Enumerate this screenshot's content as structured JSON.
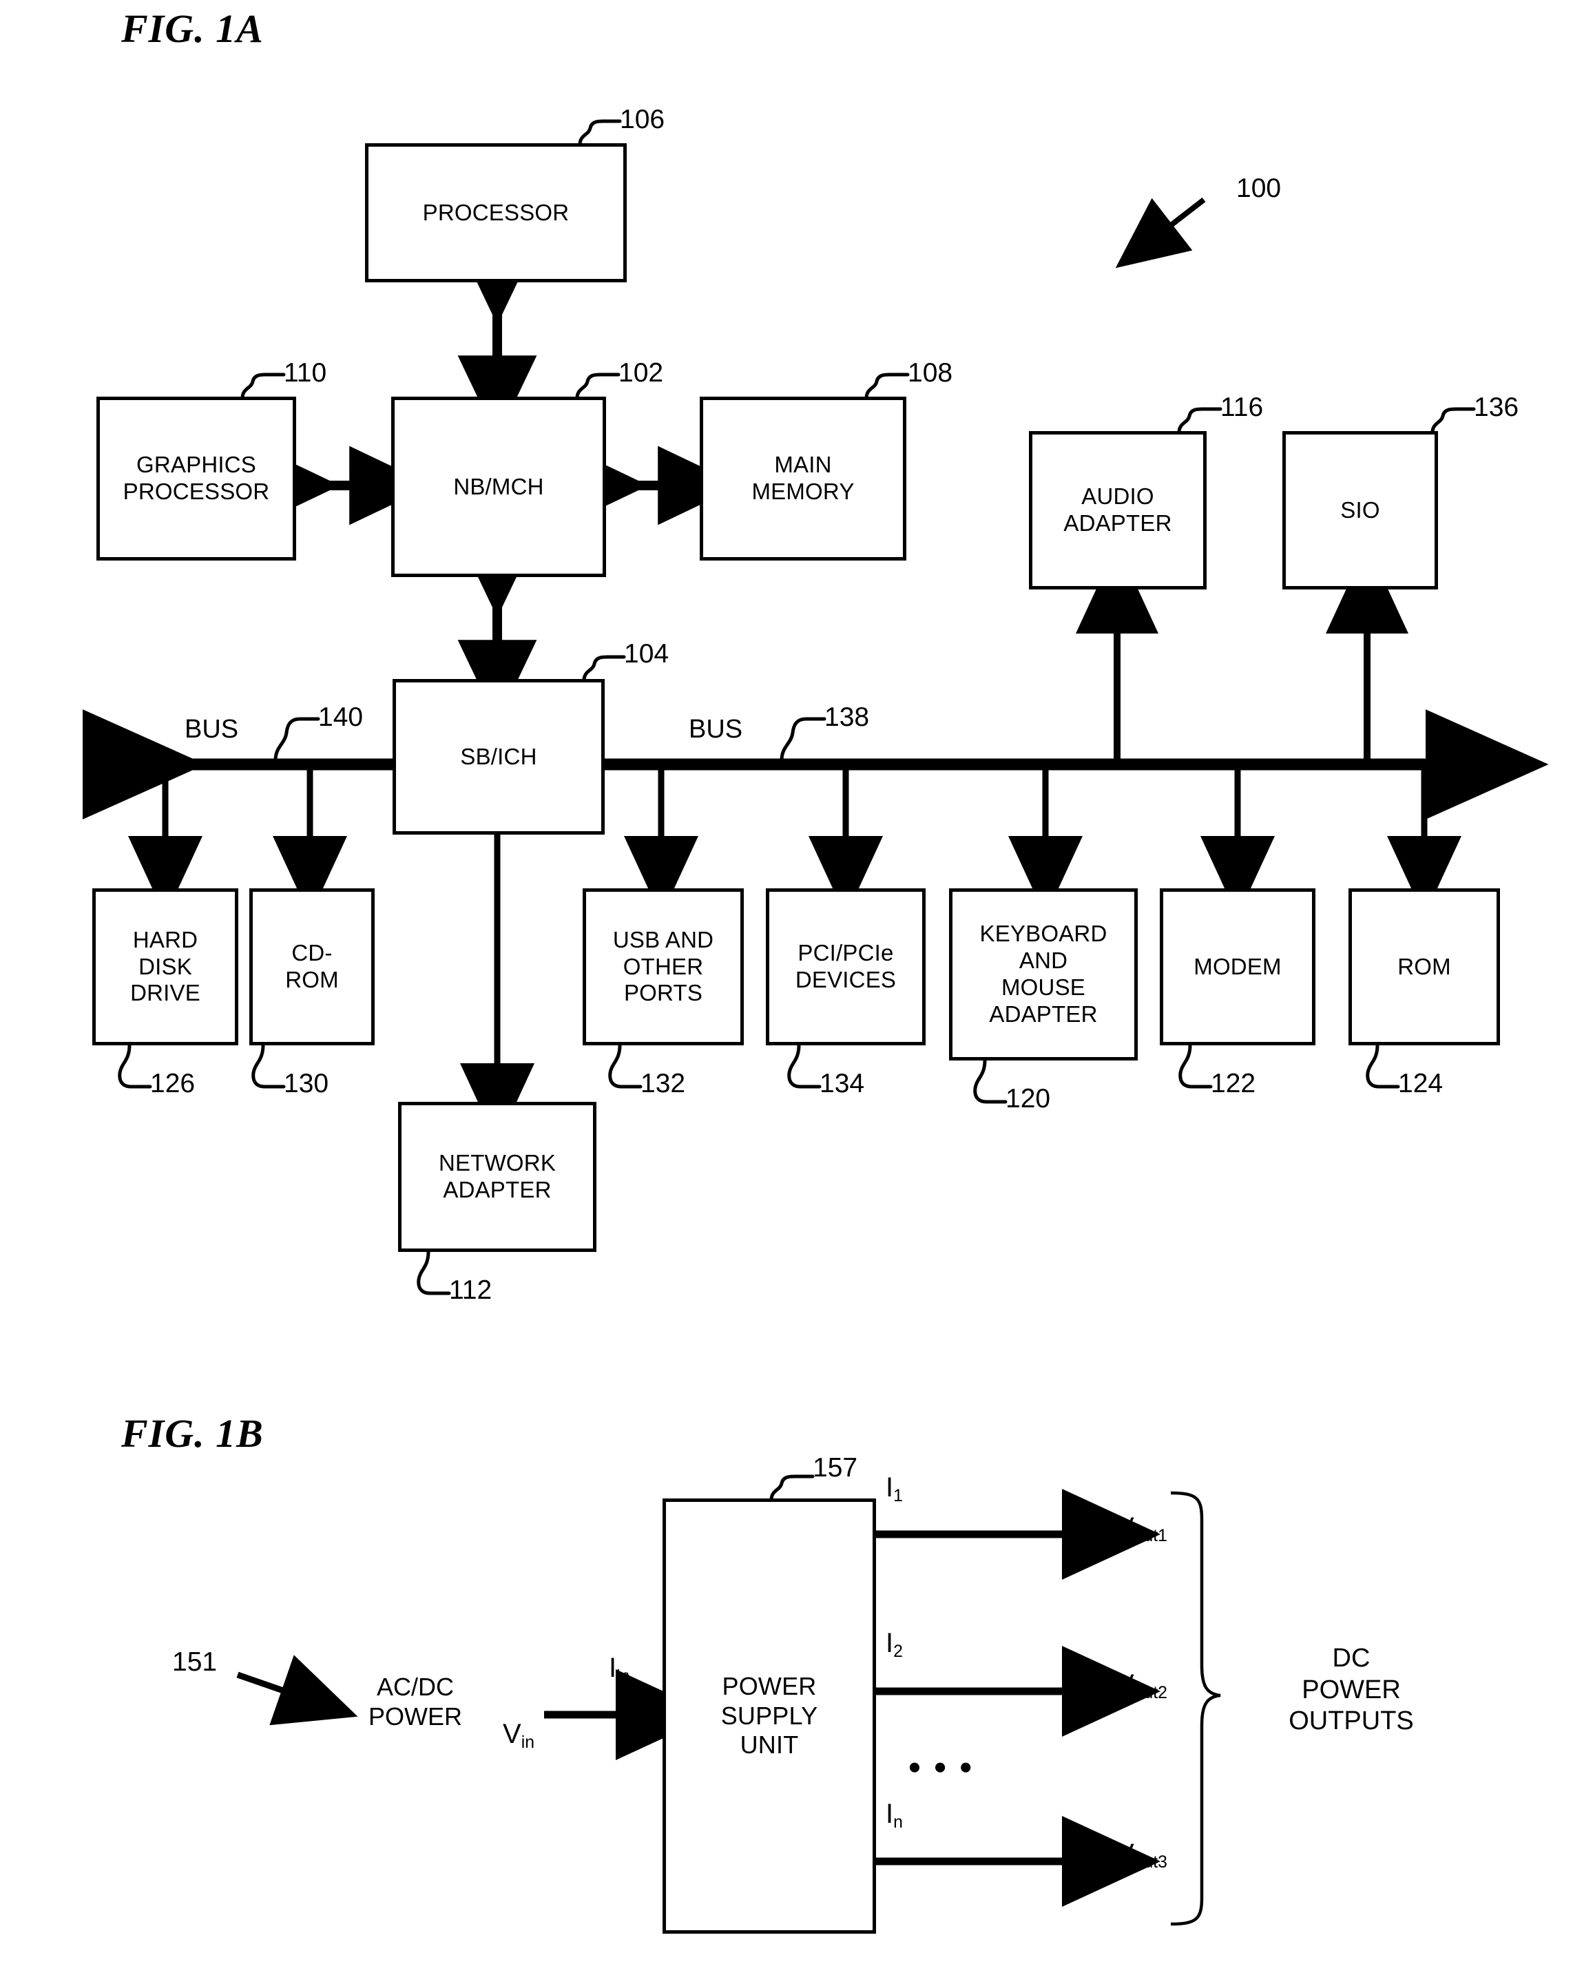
{
  "figures": {
    "fig1a_title": "FIG. 1A",
    "fig1b_title": "FIG. 1B"
  },
  "fig1a": {
    "system_ref": "100",
    "blocks": [
      {
        "label": "PROCESSOR",
        "ref": "106"
      },
      {
        "label": "GRAPHICS\nPROCESSOR",
        "ref": "110"
      },
      {
        "label": "NB/MCH",
        "ref": "102"
      },
      {
        "label": "MAIN\nMEMORY",
        "ref": "108"
      },
      {
        "label": "AUDIO\nADAPTER",
        "ref": "116"
      },
      {
        "label": "SIO",
        "ref": "136"
      },
      {
        "label": "SB/ICH",
        "ref": "104"
      },
      {
        "label": "HARD\nDISK\nDRIVE",
        "ref": "126"
      },
      {
        "label": "CD-\nROM",
        "ref": "130"
      },
      {
        "label": "USB AND\nOTHER\nPORTS",
        "ref": "132"
      },
      {
        "label": "PCI/PCIe\nDEVICES",
        "ref": "134"
      },
      {
        "label": "KEYBOARD\nAND\nMOUSE\nADAPTER",
        "ref": "120"
      },
      {
        "label": "MODEM",
        "ref": "122"
      },
      {
        "label": "ROM",
        "ref": "124"
      },
      {
        "label": "NETWORK\nADAPTER",
        "ref": "112"
      }
    ],
    "bus_left": {
      "label": "BUS",
      "ref": "140"
    },
    "bus_right": {
      "label": "BUS",
      "ref": "138"
    }
  },
  "fig1b": {
    "source_ref": "151",
    "source_label": "AC/DC\nPOWER",
    "psu_label": "POWER\nSUPPLY\nUNIT",
    "psu_ref": "157",
    "input_current": "I",
    "input_current_sub": "in",
    "input_voltage": "V",
    "input_voltage_sub": "in",
    "currents": [
      {
        "base": "I",
        "sub": "1"
      },
      {
        "base": "I",
        "sub": "2"
      },
      {
        "base": "I",
        "sub": "n"
      }
    ],
    "voltages": [
      {
        "base": "V",
        "sub": "out1"
      },
      {
        "base": "V",
        "sub": "out2"
      },
      {
        "base": "V",
        "sub": "out3"
      }
    ],
    "ellipsis": "● ● ●",
    "outputs_label": "DC\nPOWER\nOUTPUTS"
  },
  "colors": {
    "ink": "#000000",
    "paper": "#ffffff"
  }
}
